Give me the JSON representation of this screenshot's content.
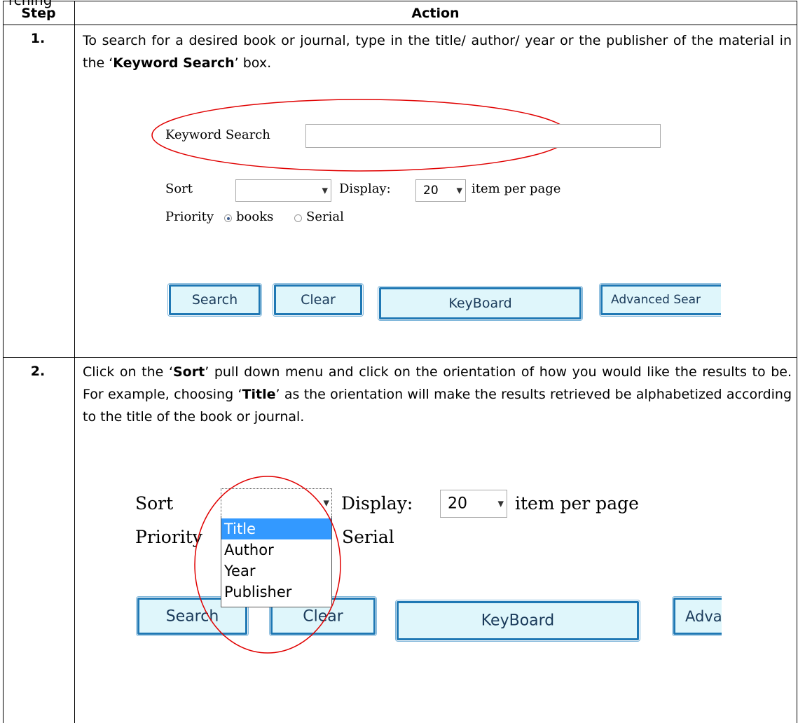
{
  "top_text": "rching",
  "table": {
    "headers": {
      "step": "Step",
      "action": "Action"
    }
  },
  "steps": [
    {
      "number": "1.",
      "text_before": "To search for a desired book or journal, type in the title/ author/ year or the publisher of the material in the ‘",
      "bold": "Keyword Search",
      "text_after": "’ box.",
      "screenshot": {
        "keyword_label": "Keyword Search",
        "keyword_value": "",
        "sort_label": "Sort",
        "sort_value": "",
        "display_label": "Display:",
        "display_value": "20",
        "per_page_label": "item per page",
        "priority_label": "Priority",
        "radio_books": "books",
        "radio_serial": "Serial",
        "buttons": {
          "search": "Search",
          "clear": "Clear",
          "keyboard": "KeyBoard",
          "advanced": "Advanced Sear"
        }
      }
    },
    {
      "number": "2.",
      "text_part1": "Click on the ‘",
      "bold1": "Sort",
      "text_part2": "’ pull down menu and click on the orientation of how you would like the results to be. For example, choosing ‘",
      "bold2": "Title",
      "text_part3": "’ as the orientation will make the results retrieved be alphabetized according to the title of the book or journal.",
      "screenshot": {
        "sort_label": "Sort",
        "display_label": "Display:",
        "display_value": "20",
        "per_page_label": "item per page",
        "priority_label": "Priority",
        "serial_label": "Serial",
        "menu_options": [
          "Title",
          "Author",
          "Year",
          "Publisher"
        ],
        "menu_selected": "Title",
        "buttons": {
          "search": "Search",
          "clear": "Clear",
          "keyboard": "KeyBoard",
          "advanced": "Advanc"
        }
      }
    }
  ],
  "colors": {
    "highlight_ellipse": "#e00000",
    "button_border": "#1f78b4",
    "button_fill": "#dff6fb",
    "menu_selected": "#3399ff"
  }
}
